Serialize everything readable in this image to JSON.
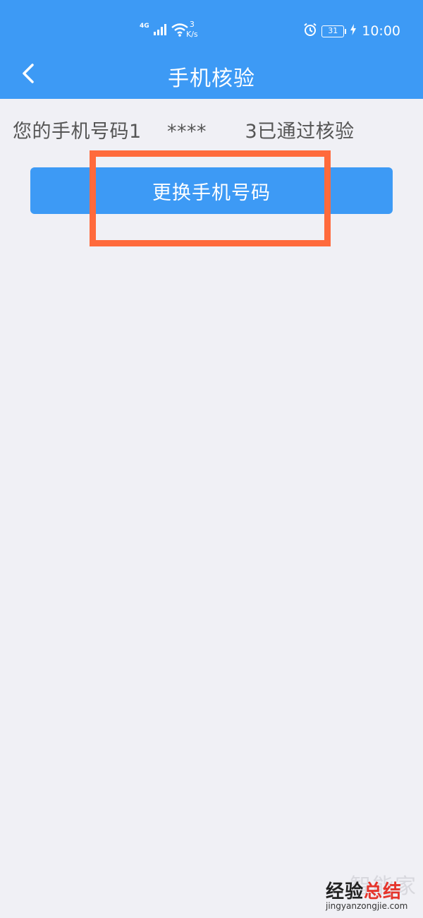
{
  "status_bar": {
    "network": "4G",
    "speed_value": "3",
    "speed_unit": "K/s",
    "battery": "31",
    "time": "10:00",
    "icons": [
      "signal-icon",
      "wifi-icon",
      "alarm-icon",
      "battery-icon",
      "charging-icon"
    ]
  },
  "navbar": {
    "title": "手机核验",
    "back_icon": "chevron-left-icon"
  },
  "main": {
    "status_text": "您的手机号码1    ****      3已通过核验",
    "change_button_label": "更换手机号码"
  },
  "annotation": {
    "highlight_color": "#ff6a3c"
  },
  "watermark": {
    "faded_text": "智能家",
    "main_text_part1": "经验",
    "main_text_part2": "总结",
    "url": "jingyanzongjie.com"
  },
  "colors": {
    "primary": "#3d9af5",
    "background": "#f0f0f5",
    "text_secondary": "#555555"
  }
}
